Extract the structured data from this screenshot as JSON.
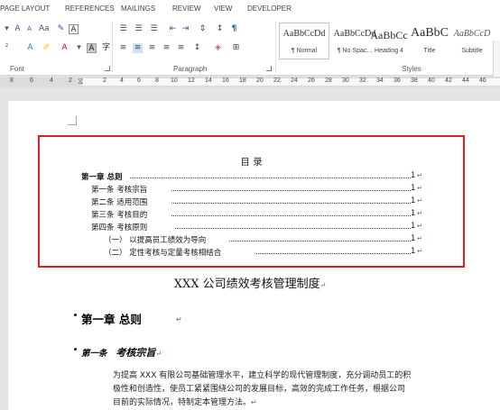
{
  "ribbon_tabs": [
    "PAGE LAYOUT",
    "REFERENCES",
    "MAILINGS",
    "REVIEW",
    "VIEW",
    "DEVELOPER"
  ],
  "groups": {
    "font": "Font",
    "paragraph": "Paragraph",
    "styles": "Styles"
  },
  "styles": [
    {
      "sample": "AaBbCcDd",
      "name": "¶ Normal"
    },
    {
      "sample": "AaBbCcDd",
      "name": "¶ No Spac..."
    },
    {
      "sample": "AaBbCc",
      "name": "Heading 4"
    },
    {
      "sample": "AaBbC",
      "name": "Title"
    },
    {
      "sample": "AaBbCcD",
      "name": "Subtitle"
    }
  ],
  "ruler_numbers": [
    "8",
    "6",
    "4",
    "2",
    "2",
    "4",
    "6",
    "8",
    "10",
    "12",
    "14",
    "16",
    "18",
    "20",
    "22",
    "24",
    "26",
    "28",
    "30",
    "32",
    "34",
    "36",
    "38",
    "40",
    "42",
    "44",
    "46"
  ],
  "toc": {
    "title": "目 录",
    "entries": [
      {
        "text": "第一章    总则",
        "page": "1"
      },
      {
        "text": "第一条    考核宗旨",
        "page": "1"
      },
      {
        "text": "第二条    适用范围",
        "page": "1"
      },
      {
        "text": "第三条    考核目的",
        "page": "1"
      },
      {
        "text": "第四条    考核原则",
        "page": "1"
      },
      {
        "text": "（一）    以提高员工绩效为导向",
        "page": "1"
      },
      {
        "text": "（二）    定性考核与定量考核相结合",
        "page": "1"
      }
    ]
  },
  "document": {
    "title": "XXX 公司绩效考核管理制度",
    "chapter_heading": "第一章    总则",
    "article_label": "第一条",
    "article_title": "考核宗旨",
    "body_lines": [
      "为提高 XXX 有限公司基础管理水平，建立科学的现代管理制度，充分调动员工的积",
      "极性和创造性，使员工紧紧围绕公司的发展目标，高效的完成工作任务，根据公司",
      "目前的实际情况，特制定本管理方法。"
    ],
    "paragraph_mark": "↵"
  }
}
